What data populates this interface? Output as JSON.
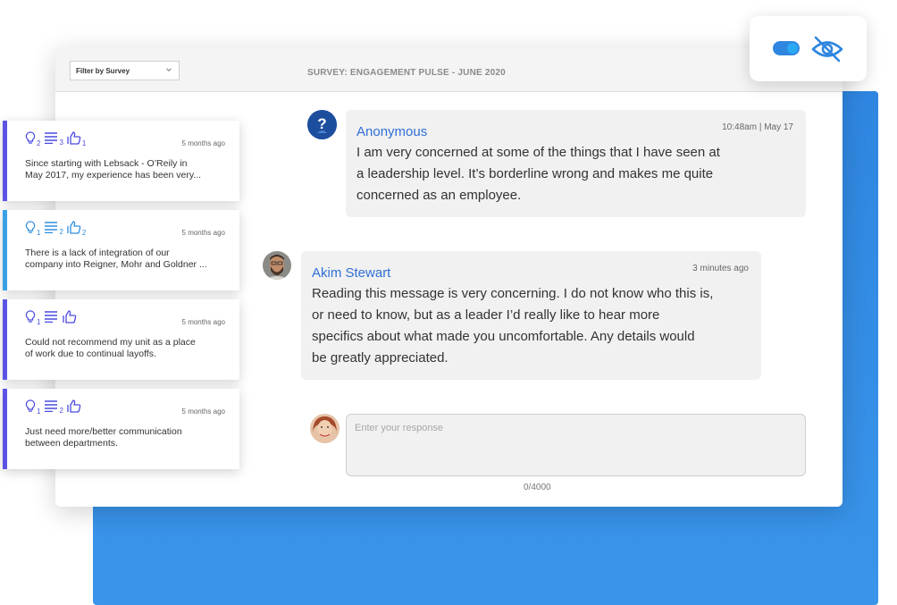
{
  "filter": {
    "label": "Filter by Survey"
  },
  "survey": {
    "title": "SURVEY: ENGAGEMENT PULSE - JUNE 2020"
  },
  "messages": [
    {
      "author": "Anonymous",
      "time": "10:48am | May 17",
      "lines": [
        "I am very concerned at some of the things that I have seen at",
        "a leadership level. It’s borderline wrong and makes me quite",
        "concerned as an employee."
      ]
    },
    {
      "author": "Akim Stewart",
      "time": "3 minutes ago",
      "lines": [
        "Reading this message is very concerning. I do not know who this is,",
        "or need to know, but as a leader I’d really like to hear more",
        "specifics about what made you uncomfortable. Any details would",
        "be greatly appreciated."
      ]
    }
  ],
  "response": {
    "placeholder": "Enter your response",
    "count": "0/4000"
  },
  "cards": [
    {
      "ideas": "2",
      "comments": "3",
      "likes": "1",
      "ago": "5 months ago",
      "line1": "Since starting with Lebsack - O’Reily in",
      "line2": "May 2017, my experience has been very..."
    },
    {
      "ideas": "1",
      "comments": "2",
      "likes": "2",
      "ago": "5 months ago",
      "line1": "There is a lack of integration of our",
      "line2": "company into Reigner, Mohr and Goldner ..."
    },
    {
      "ideas": "1",
      "comments": "",
      "likes": "",
      "ago": "5 months ago",
      "line1": "Could not recommend my unit as a place",
      "line2": "of work due to continual layoffs."
    },
    {
      "ideas": "1",
      "comments": "2",
      "likes": "",
      "ago": "5 months ago",
      "line1": "Just need more/better communication",
      "line2": "between departments."
    }
  ],
  "icons": {
    "idea": "lightbulb-icon",
    "comment": "lines-icon",
    "like": "thumbs-up-icon",
    "anonymous": "question-mark-icon",
    "visibility": "eye-off-icon"
  },
  "colors": {
    "accent_blue": "#2f86e0",
    "link_blue": "#2f6fd6",
    "purple": "#5b54e3"
  }
}
